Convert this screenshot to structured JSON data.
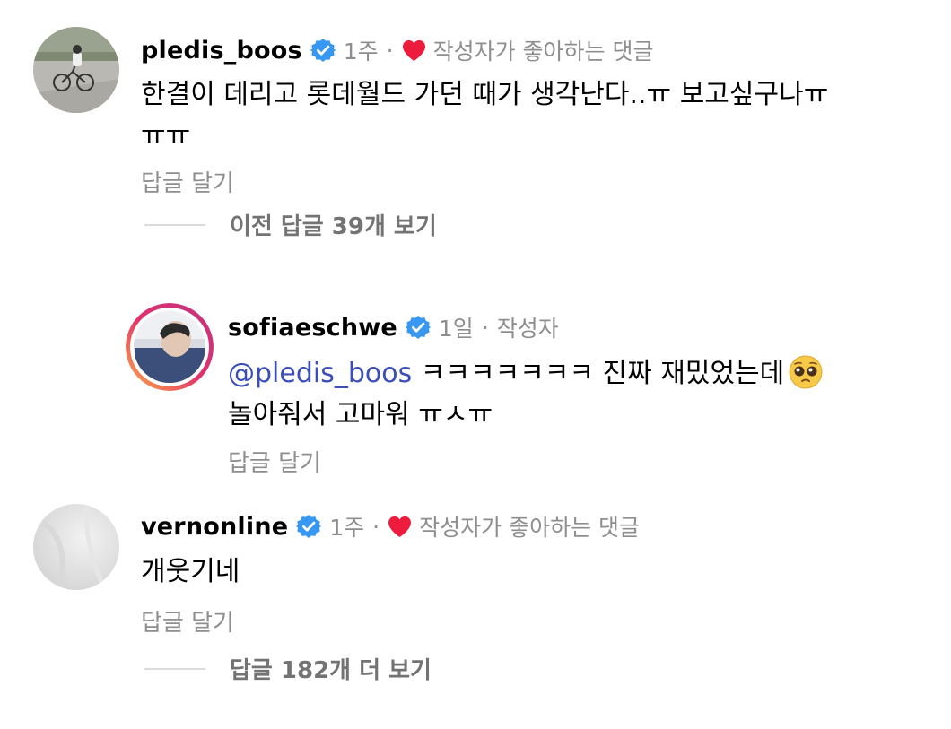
{
  "colors": {
    "verified_blue": "#3897f0",
    "heart_red": "#ed1c3d",
    "mention_blue": "#3b4db8",
    "meta_gray": "#8e8e8e",
    "story_ring": [
      "#fcaf45",
      "#e1306c",
      "#c13584"
    ]
  },
  "comments": [
    {
      "username": "pledis_boos",
      "verified": true,
      "time": "1주",
      "separator": "·",
      "liked_label": "작성자가 좋아하는 댓글",
      "icons": [
        "verified-badge-icon",
        "heart-icon"
      ],
      "text_line1": "한결이 데리고 롯데월드 가던 때가 생각난다..ㅠ 보고싶구나ㅠ",
      "text_line2": "ㅠㅠ",
      "reply_label": "답글 달기",
      "view_replies": "이전 답글 39개 보기"
    },
    {
      "username": "sofiaeschwe",
      "verified": true,
      "time": "1일",
      "separator": "·",
      "author_label": "작성자",
      "icons": [
        "verified-badge-icon",
        "pleading-face-emoji"
      ],
      "mention": "@pledis_boos",
      "text_line1_rest": " ㅋㅋㅋㅋㅋㅋㅋ 진짜 재밌었는데",
      "text_line2": "놀아줘서 고마워 ㅠㅅㅠ",
      "reply_label": "답글 달기"
    },
    {
      "username": "vernonline",
      "verified": true,
      "time": "1주",
      "separator": "·",
      "liked_label": "작성자가 좋아하는 댓글",
      "icons": [
        "verified-badge-icon",
        "heart-icon"
      ],
      "text_line1": "개웃기네",
      "reply_label": "답글 달기",
      "view_replies": "답글 182개 더 보기"
    }
  ]
}
